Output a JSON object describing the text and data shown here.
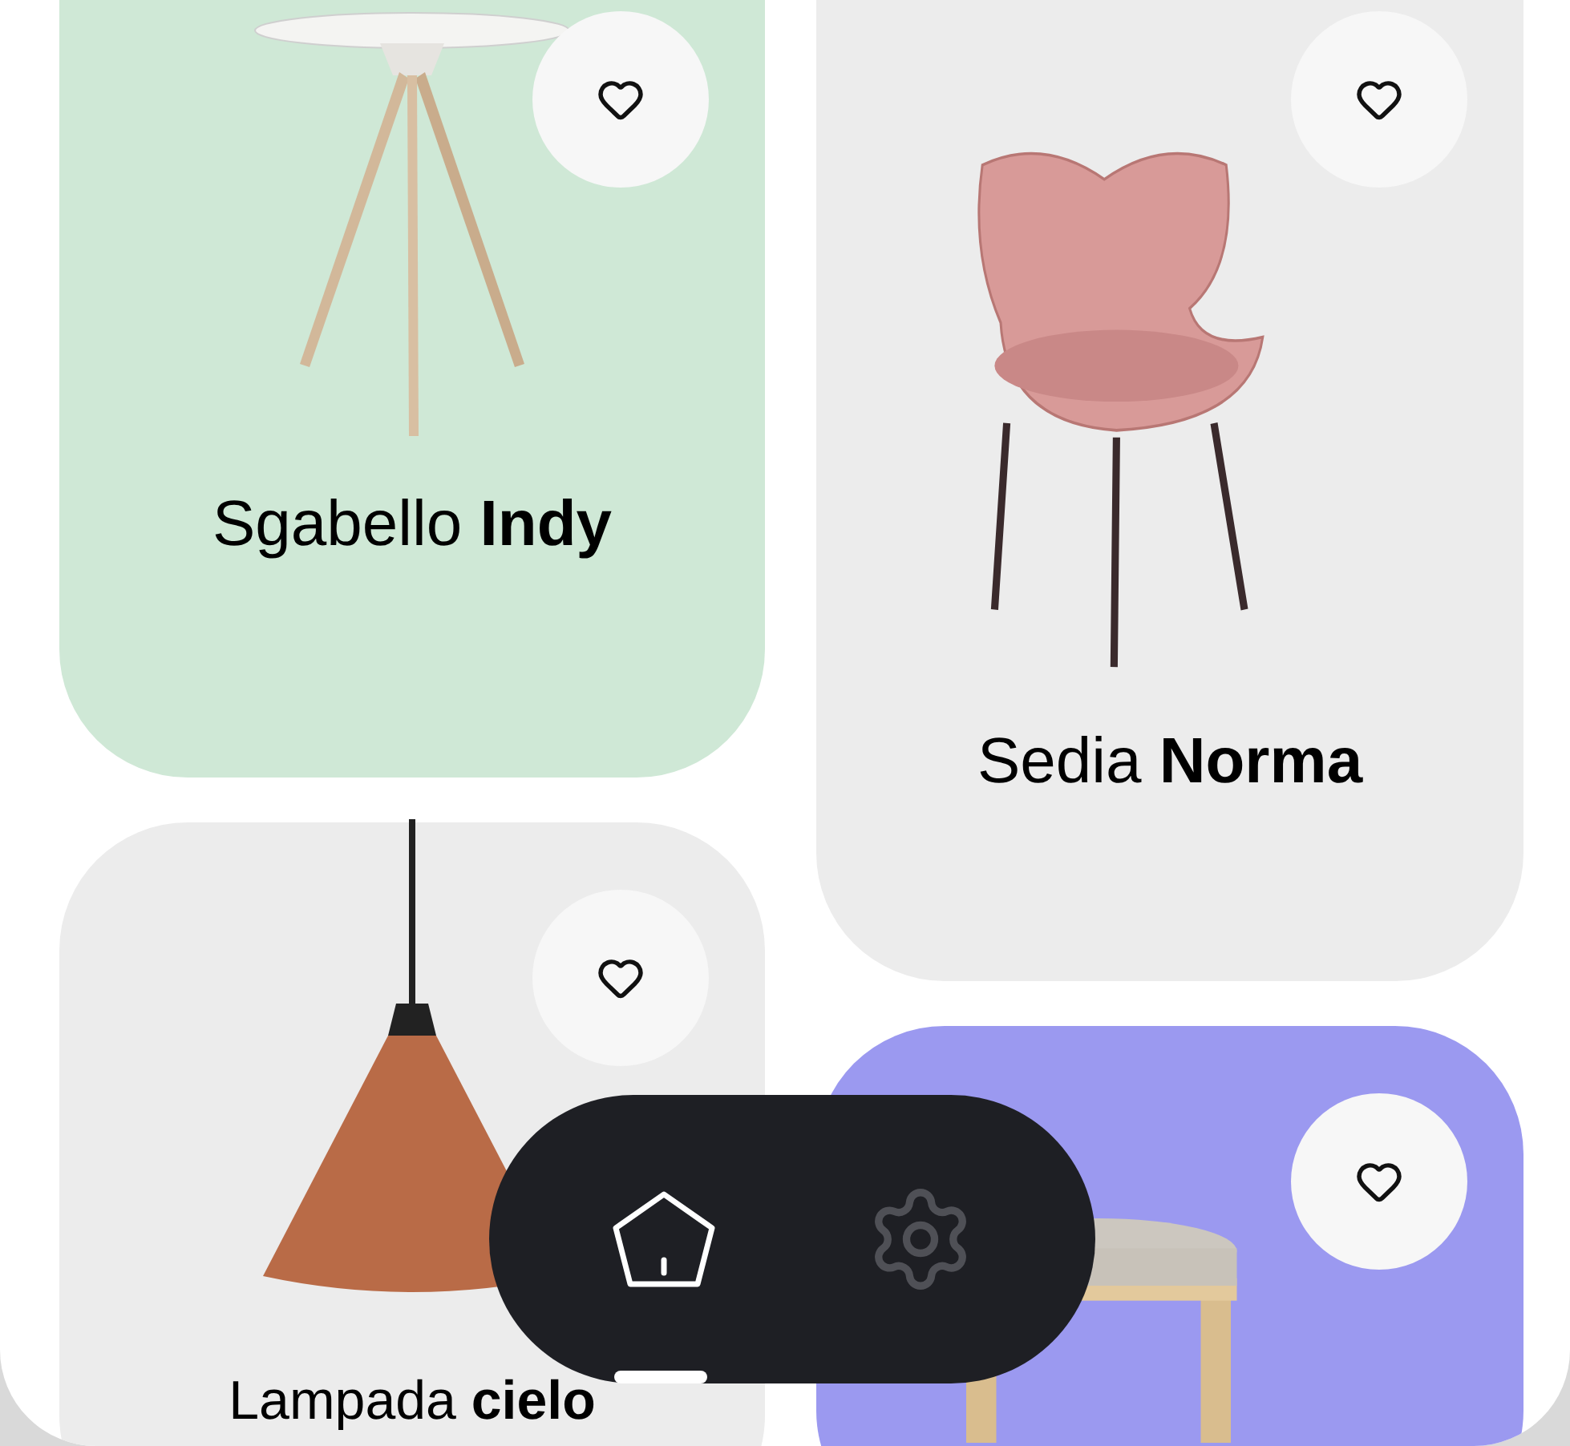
{
  "products": [
    {
      "name": "Sgabello **Indy**",
      "kind": "side-table",
      "color": "#cfe8d6"
    },
    {
      "name": "Lampada **cielo**",
      "kind": "lamp",
      "color": "#ececec"
    },
    {
      "name": "Sedia **Norma**",
      "kind": "chair",
      "color": "#ececec"
    },
    {
      "kind": "stool",
      "color": "#9b99f0"
    }
  ],
  "nav": [
    {
      "kind": "home",
      "selected": true
    },
    {
      "kind": "settings",
      "selected": false
    }
  ]
}
